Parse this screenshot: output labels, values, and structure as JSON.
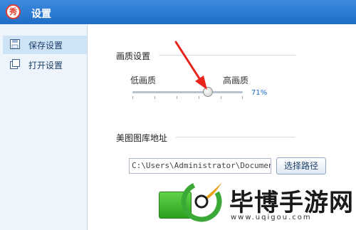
{
  "window": {
    "title": "设置",
    "app_logo_text": "秀"
  },
  "sidebar": {
    "items": [
      {
        "label": "保存设置",
        "icon": "save-icon",
        "active": true
      },
      {
        "label": "打开设置",
        "icon": "open-icon",
        "active": false
      }
    ]
  },
  "quality": {
    "section_title": "画质设置",
    "low_label": "低画质",
    "high_label": "高画质",
    "value_text": "71%",
    "value": 71
  },
  "library": {
    "section_title": "美图图库地址",
    "path_value": "C:\\Users\\Administrator\\Documents",
    "browse_label": "选择路径"
  },
  "watermark": {
    "text": "毕博手游网",
    "url": "www.uqigou.com"
  },
  "colors": {
    "titlebar": "#2f7ed8",
    "ok_button": "#3cb52e",
    "arrow": "#e8231c",
    "slider_value": "#1a6fd1"
  }
}
